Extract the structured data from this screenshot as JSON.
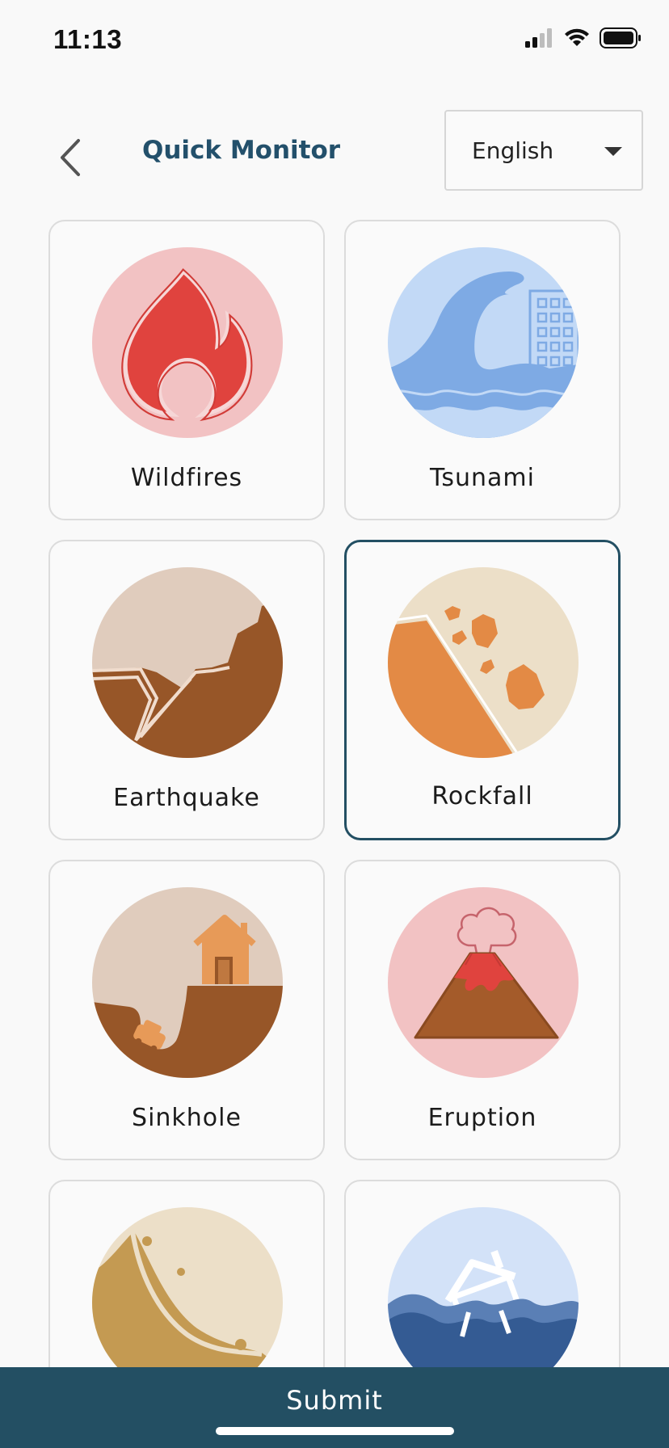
{
  "status_bar": {
    "time": "11:13",
    "icons": [
      "signal-icon",
      "wifi-icon",
      "battery-icon"
    ]
  },
  "header": {
    "back_icon": "chevron-left-icon",
    "title": "Quick Monitor",
    "language": {
      "selected": "English",
      "caret_icon": "caret-down-icon"
    }
  },
  "hazards": [
    {
      "label": "Wildfires",
      "icon": "wildfire-icon",
      "selected": false
    },
    {
      "label": "Tsunami",
      "icon": "tsunami-icon",
      "selected": false
    },
    {
      "label": "Earthquake",
      "icon": "earthquake-icon",
      "selected": false
    },
    {
      "label": "Rockfall",
      "icon": "rockfall-icon",
      "selected": true
    },
    {
      "label": "Sinkhole",
      "icon": "sinkhole-icon",
      "selected": false
    },
    {
      "label": "Eruption",
      "icon": "eruption-icon",
      "selected": false
    },
    {
      "label": "",
      "icon": "landslide-icon",
      "selected": false
    },
    {
      "label": "",
      "icon": "flood-icon",
      "selected": false
    }
  ],
  "submit": {
    "label": "Submit"
  },
  "colors": {
    "primary": "#234f63",
    "background": "#f9f9f9",
    "card_border": "#dcdcdc"
  }
}
